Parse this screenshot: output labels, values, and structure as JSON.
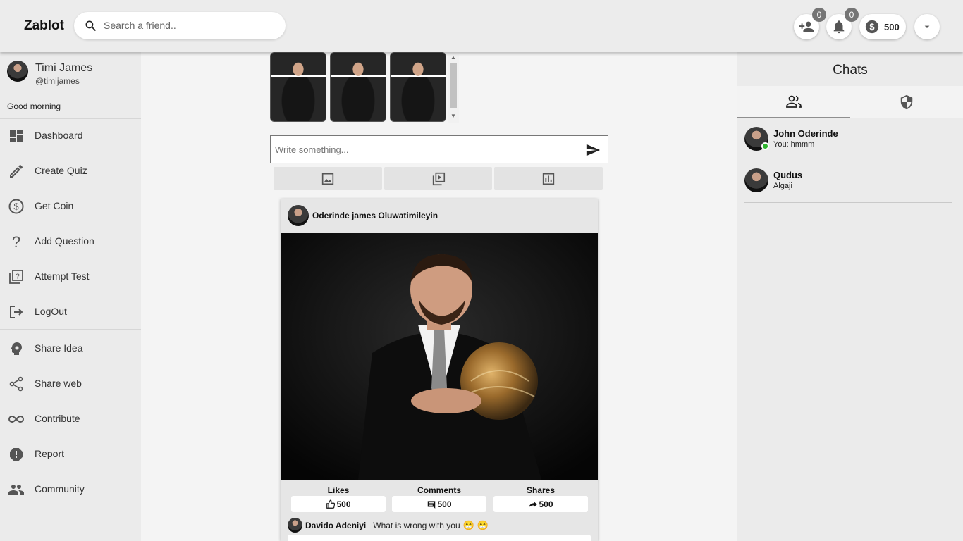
{
  "header": {
    "brand": "Zablot",
    "search_placeholder": "Search a friend..",
    "friend_requests_count": "0",
    "notifications_count": "0",
    "coins": "500"
  },
  "sidebar": {
    "user_name": "Timi James",
    "user_handle": "@timijames",
    "greeting": "Good morning",
    "items": [
      {
        "label": "Dashboard",
        "icon": "dashboard-icon"
      },
      {
        "label": "Create Quiz",
        "icon": "pencil-icon"
      },
      {
        "label": "Get Coin",
        "icon": "coin-icon"
      },
      {
        "label": "Add Question",
        "icon": "question-icon"
      },
      {
        "label": "Attempt Test",
        "icon": "quiz-icon"
      },
      {
        "label": "LogOut",
        "icon": "logout-icon"
      },
      {
        "label": "Share Idea",
        "icon": "psychology-icon"
      },
      {
        "label": "Share web",
        "icon": "share-icon"
      },
      {
        "label": "Contribute",
        "icon": "infinity-icon"
      },
      {
        "label": "Report",
        "icon": "report-icon"
      },
      {
        "label": "Community",
        "icon": "people-icon"
      }
    ]
  },
  "composer": {
    "placeholder": "Write something..."
  },
  "post": {
    "author": "Oderinde james Oluwatimileyin",
    "stats": {
      "likes_label": "Likes",
      "likes": "500",
      "comments_label": "Comments",
      "comments": "500",
      "shares_label": "Shares",
      "shares": "500"
    },
    "comment": {
      "author": "Davido Adeniyi",
      "text": "What is wrong with you",
      "emoji": "😁 😁"
    }
  },
  "chats": {
    "title": "Chats",
    "tabs": [
      {
        "icon": "people-outline-icon",
        "active": true
      },
      {
        "icon": "shield-icon",
        "active": false
      }
    ],
    "items": [
      {
        "name": "John Oderinde",
        "message": "You: hmmm",
        "online": true
      },
      {
        "name": "Qudus",
        "message": "Algaji",
        "online": false
      }
    ]
  },
  "colors": {
    "online": "#2fb52f",
    "badge": "#757575",
    "panel": "#ebebeb"
  }
}
